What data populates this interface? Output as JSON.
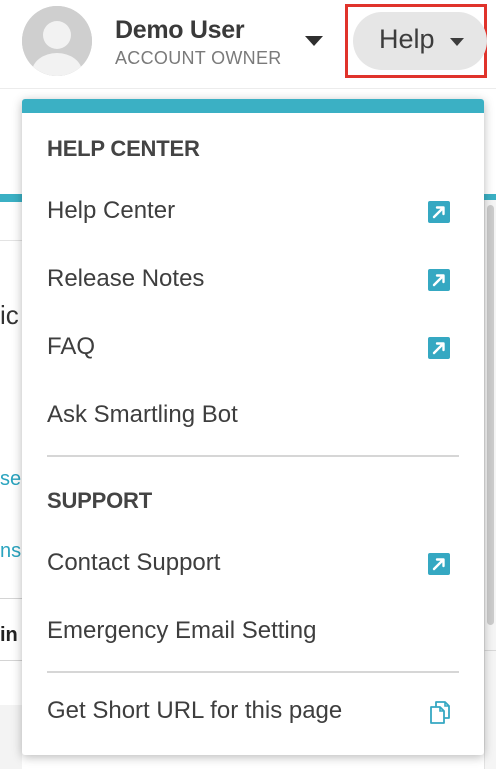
{
  "header": {
    "user_name": "Demo User",
    "user_role": "ACCOUNT OWNER",
    "help_label": "Help"
  },
  "background": {
    "fragments": [
      "ic",
      "se",
      "ns",
      "in"
    ]
  },
  "menu": {
    "help_center_heading": "HELP CENTER",
    "help_center_items": [
      {
        "label": "Help Center",
        "icon": "external-link-icon"
      },
      {
        "label": "Release Notes",
        "icon": "external-link-icon"
      },
      {
        "label": "FAQ",
        "icon": "external-link-icon"
      },
      {
        "label": "Ask Smartling Bot",
        "icon": ""
      }
    ],
    "support_heading": "SUPPORT",
    "support_items": [
      {
        "label": "Contact Support",
        "icon": "external-link-icon"
      },
      {
        "label": "Emergency Email Setting",
        "icon": ""
      }
    ],
    "short_url": {
      "label": "Get Short URL for this page",
      "icon": "copy-icon"
    }
  },
  "colors": {
    "accent": "#3bb0c4",
    "highlight": "#e0332b",
    "icon": "#35a8c2"
  }
}
